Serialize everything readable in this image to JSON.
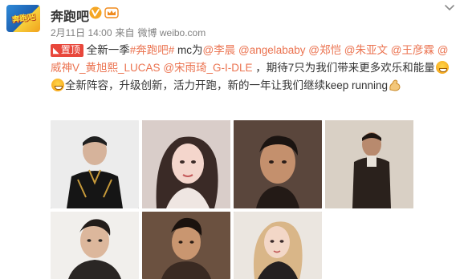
{
  "post": {
    "author": "奔跑吧",
    "avatar_logo_text": "奔跑吧",
    "date": "2月11日 14:00",
    "source_prefix": "来自",
    "source": "微博 weibo.com",
    "pin_label": "置顶",
    "body_segments": [
      {
        "text": "全新一季",
        "type": "text"
      },
      {
        "text": "#奔跑吧#",
        "type": "link"
      },
      {
        "text": " mc为",
        "type": "text"
      },
      {
        "text": "@李晨",
        "type": "link"
      },
      {
        "text": " ",
        "type": "text"
      },
      {
        "text": "@angelababy",
        "type": "link"
      },
      {
        "text": " ",
        "type": "text"
      },
      {
        "text": "@郑恺",
        "type": "link"
      },
      {
        "text": " ",
        "type": "text"
      },
      {
        "text": "@朱亚文",
        "type": "link"
      },
      {
        "text": " ",
        "type": "text"
      },
      {
        "text": "@王彦霖",
        "type": "link"
      },
      {
        "text": " ",
        "type": "text"
      },
      {
        "text": "@威神V_黄旭熙_LUCAS",
        "type": "link"
      },
      {
        "text": " ",
        "type": "text"
      },
      {
        "text": "@宋雨琦_G-I-DLE",
        "type": "link"
      },
      {
        "text": " ，期待7只为我们带来更多欢乐和能量",
        "type": "text"
      },
      {
        "text": "grin",
        "type": "emoji"
      },
      {
        "text": "grin",
        "type": "emoji"
      },
      {
        "text": "全新阵容，升级创新，活力开跑，新的一年让我们继续keep running",
        "type": "text"
      },
      {
        "text": "strong",
        "type": "emoji-strong"
      }
    ]
  },
  "colors": {
    "link": "#eb7350",
    "pin_badge": "#e8473b",
    "verified": "#f5a623",
    "meta_text": "#808080"
  },
  "icons": {
    "verified": "verified-v-icon",
    "vip": "vip-crown-icon",
    "menu": "chevron-down-icon",
    "pin": "pin-icon"
  },
  "photos": [
    {
      "name": "photo-1"
    },
    {
      "name": "photo-2"
    },
    {
      "name": "photo-3"
    },
    {
      "name": "photo-4"
    },
    {
      "name": "photo-5"
    },
    {
      "name": "photo-6"
    },
    {
      "name": "photo-7"
    }
  ]
}
